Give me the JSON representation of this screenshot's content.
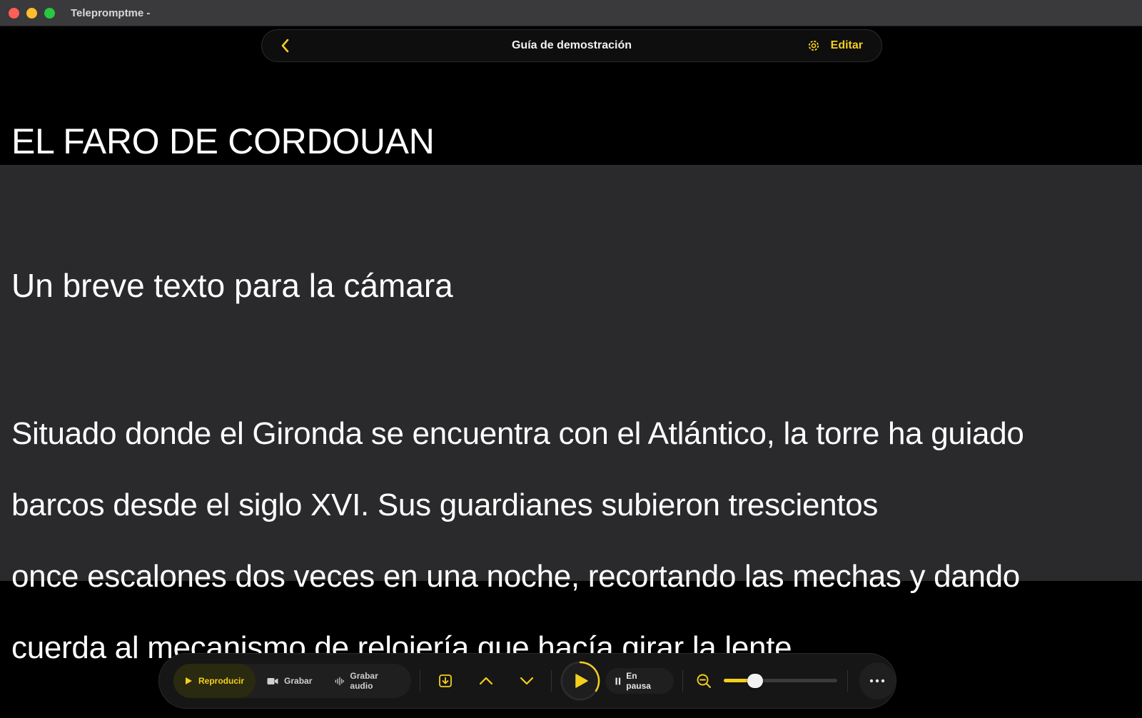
{
  "window": {
    "app_title": "Telepromptme -"
  },
  "header": {
    "document_title": "Guía de demostración",
    "edit_label": "Editar"
  },
  "script": {
    "title": "EL FARO DE CORDOUAN",
    "subtitle": "Un breve texto para la cámara",
    "lines": [
      "Situado donde el Gironda se encuentra con el Atlántico, la torre ha guiado",
      "barcos desde el siglo XVI. Sus guardianes subieron trescientos",
      "once escalones dos veces en una noche, recortando las mechas y dando",
      "cuerda al mecanismo de relojería que hacía girar la lente."
    ]
  },
  "controls": {
    "play_label": "Reproducir",
    "record_label": "Grabar",
    "record_audio_label": "Grabar audio",
    "status_label": "En pausa",
    "speed_level": 0.24
  },
  "colors": {
    "accent": "#f5cf1e",
    "focus_band": "#2a2a2c",
    "background": "#000000"
  },
  "icons": {
    "back": "chevron-left-icon",
    "settings": "gear-icon",
    "play": "play-icon",
    "camera": "video-camera-icon",
    "waveform": "waveform-icon",
    "import": "import-icon",
    "up": "chevron-up-icon",
    "down": "chevron-down-icon",
    "pause": "pause-icon",
    "zoom": "zoom-out-icon",
    "more": "ellipsis-icon"
  }
}
